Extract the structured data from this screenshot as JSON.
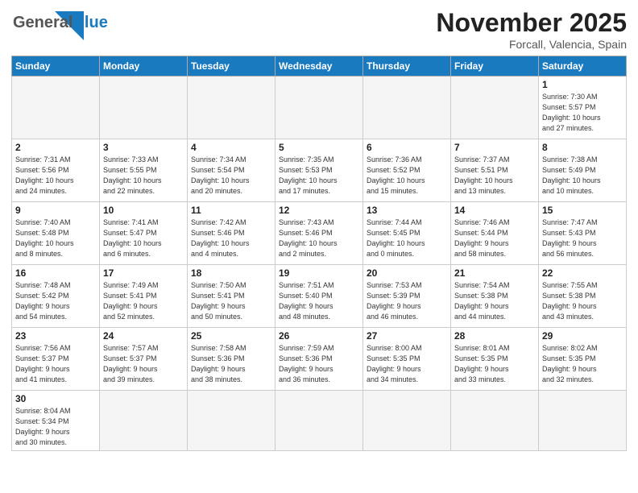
{
  "header": {
    "logo_general": "General",
    "logo_blue": "Blue",
    "month_title": "November 2025",
    "location": "Forcall, Valencia, Spain"
  },
  "weekdays": [
    "Sunday",
    "Monday",
    "Tuesday",
    "Wednesday",
    "Thursday",
    "Friday",
    "Saturday"
  ],
  "days": {
    "1": {
      "sunrise": "7:30 AM",
      "sunset": "5:57 PM",
      "daylight": "10 hours and 27 minutes."
    },
    "2": {
      "sunrise": "7:31 AM",
      "sunset": "5:56 PM",
      "daylight": "10 hours and 24 minutes."
    },
    "3": {
      "sunrise": "7:33 AM",
      "sunset": "5:55 PM",
      "daylight": "10 hours and 22 minutes."
    },
    "4": {
      "sunrise": "7:34 AM",
      "sunset": "5:54 PM",
      "daylight": "10 hours and 20 minutes."
    },
    "5": {
      "sunrise": "7:35 AM",
      "sunset": "5:53 PM",
      "daylight": "10 hours and 17 minutes."
    },
    "6": {
      "sunrise": "7:36 AM",
      "sunset": "5:52 PM",
      "daylight": "10 hours and 15 minutes."
    },
    "7": {
      "sunrise": "7:37 AM",
      "sunset": "5:51 PM",
      "daylight": "10 hours and 13 minutes."
    },
    "8": {
      "sunrise": "7:38 AM",
      "sunset": "5:49 PM",
      "daylight": "10 hours and 10 minutes."
    },
    "9": {
      "sunrise": "7:40 AM",
      "sunset": "5:48 PM",
      "daylight": "10 hours and 8 minutes."
    },
    "10": {
      "sunrise": "7:41 AM",
      "sunset": "5:47 PM",
      "daylight": "10 hours and 6 minutes."
    },
    "11": {
      "sunrise": "7:42 AM",
      "sunset": "5:46 PM",
      "daylight": "10 hours and 4 minutes."
    },
    "12": {
      "sunrise": "7:43 AM",
      "sunset": "5:46 PM",
      "daylight": "10 hours and 2 minutes."
    },
    "13": {
      "sunrise": "7:44 AM",
      "sunset": "5:45 PM",
      "daylight": "10 hours and 0 minutes."
    },
    "14": {
      "sunrise": "7:46 AM",
      "sunset": "5:44 PM",
      "daylight": "9 hours and 58 minutes."
    },
    "15": {
      "sunrise": "7:47 AM",
      "sunset": "5:43 PM",
      "daylight": "9 hours and 56 minutes."
    },
    "16": {
      "sunrise": "7:48 AM",
      "sunset": "5:42 PM",
      "daylight": "9 hours and 54 minutes."
    },
    "17": {
      "sunrise": "7:49 AM",
      "sunset": "5:41 PM",
      "daylight": "9 hours and 52 minutes."
    },
    "18": {
      "sunrise": "7:50 AM",
      "sunset": "5:41 PM",
      "daylight": "9 hours and 50 minutes."
    },
    "19": {
      "sunrise": "7:51 AM",
      "sunset": "5:40 PM",
      "daylight": "9 hours and 48 minutes."
    },
    "20": {
      "sunrise": "7:53 AM",
      "sunset": "5:39 PM",
      "daylight": "9 hours and 46 minutes."
    },
    "21": {
      "sunrise": "7:54 AM",
      "sunset": "5:38 PM",
      "daylight": "9 hours and 44 minutes."
    },
    "22": {
      "sunrise": "7:55 AM",
      "sunset": "5:38 PM",
      "daylight": "9 hours and 43 minutes."
    },
    "23": {
      "sunrise": "7:56 AM",
      "sunset": "5:37 PM",
      "daylight": "9 hours and 41 minutes."
    },
    "24": {
      "sunrise": "7:57 AM",
      "sunset": "5:37 PM",
      "daylight": "9 hours and 39 minutes."
    },
    "25": {
      "sunrise": "7:58 AM",
      "sunset": "5:36 PM",
      "daylight": "9 hours and 38 minutes."
    },
    "26": {
      "sunrise": "7:59 AM",
      "sunset": "5:36 PM",
      "daylight": "9 hours and 36 minutes."
    },
    "27": {
      "sunrise": "8:00 AM",
      "sunset": "5:35 PM",
      "daylight": "9 hours and 34 minutes."
    },
    "28": {
      "sunrise": "8:01 AM",
      "sunset": "5:35 PM",
      "daylight": "9 hours and 33 minutes."
    },
    "29": {
      "sunrise": "8:02 AM",
      "sunset": "5:35 PM",
      "daylight": "9 hours and 32 minutes."
    },
    "30": {
      "sunrise": "8:04 AM",
      "sunset": "5:34 PM",
      "daylight": "9 hours and 30 minutes."
    }
  }
}
